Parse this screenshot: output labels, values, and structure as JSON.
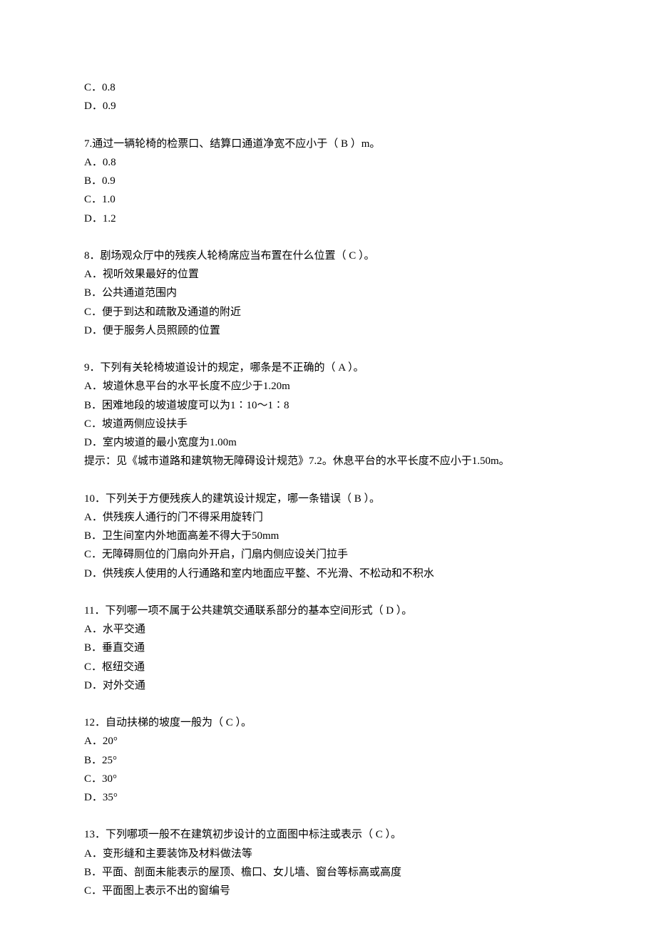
{
  "lines": [
    "C．0.8",
    "D．0.9",
    "",
    "7.通过一辆轮椅的检票口、结算口通道净宽不应小于（ B ）m。",
    "A．0.8",
    "B．0.9",
    "C．1.0",
    "D．1.2",
    "",
    "8．剧场观众厅中的残疾人轮椅席应当布置在什么位置（ C ）。",
    "A．视听效果最好的位置",
    "B．公共通道范围内",
    "C．便于到达和疏散及通道的附近",
    "D．便于服务人员照顾的位置",
    "",
    "9．下列有关轮椅坡道设计的规定，哪条是不正确的（ A ）。",
    "A．坡道休息平台的水平长度不应少于1.20m",
    "B．困难地段的坡道坡度可以为1∶10～1∶8",
    "C．坡道两侧应设扶手",
    "D．室内坡道的最小宽度为1.00m",
    "提示：见《城市道路和建筑物无障碍设计规范》7.2。休息平台的水平长度不应小于1.50m。",
    "",
    "10．下列关于方便残疾人的建筑设计规定，哪一条错误（ B ）。",
    "A．供残疾人通行的门不得采用旋转门",
    "B．卫生间室内外地面高差不得大于50mm",
    "C．无障碍厕位的门扇向外开启，门扇内侧应设关门拉手",
    "D．供残疾人使用的人行通路和室内地面应平整、不光滑、不松动和不积水",
    "",
    "11．下列哪一项不属于公共建筑交通联系部分的基本空间形式（ D ）。",
    "A．水平交通",
    "B．垂直交通",
    "C．枢纽交通",
    "D．对外交通",
    "",
    "12．自动扶梯的坡度一般为（ C ）。",
    "A．20°",
    "B．25°",
    "C．30°",
    "D．35°",
    "",
    "13．下列哪项一般不在建筑初步设计的立面图中标注或表示（ C ）。",
    "A．变形缝和主要装饰及材料做法等",
    "B．平面、剖面未能表示的屋顶、檐口、女儿墙、窗台等标高或高度",
    "C．平面图上表示不出的窗编号"
  ]
}
